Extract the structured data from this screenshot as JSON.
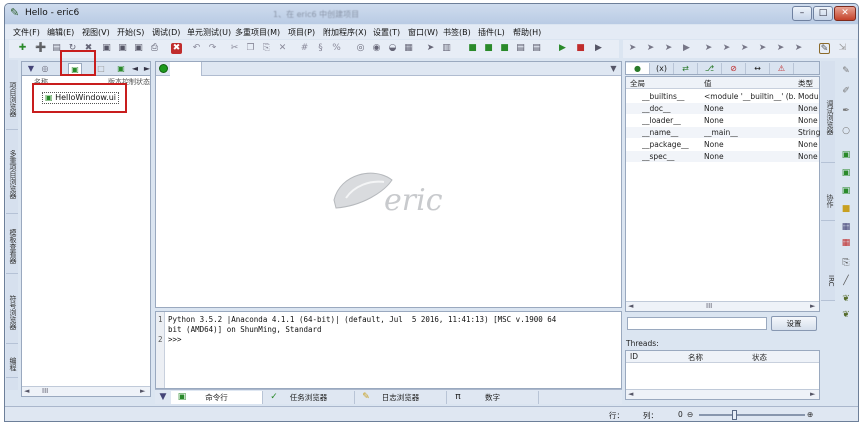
{
  "window": {
    "title": "Hello - eric6",
    "overlay_caption": "1、在 eric6 中创建项目",
    "minimize": "–",
    "maximize": "□",
    "close": "✕"
  },
  "menu": [
    "文件(F)",
    "编辑(E)",
    "视图(V)",
    "开始(S)",
    "调试(D)",
    "单元测试(U)",
    "多重项目(M)",
    "项目(P)",
    "附加程序(X)",
    "设置(T)",
    "窗口(W)",
    "书签(B)",
    "插件(L)",
    "帮助(H)"
  ],
  "left_vertical_tabs": [
    "项目浏览器",
    "多重项目浏览器",
    "模板查看器",
    "符号浏览器",
    "编程"
  ],
  "project_panel": {
    "header_name": "名称",
    "header_vcs": "版本控制状态",
    "tree_item": "HelloWindow.ui"
  },
  "editor": {
    "logo_text": "eric"
  },
  "shell": {
    "line_numbers": [
      "1",
      "",
      "2"
    ],
    "lines": [
      "Python 3.5.2 |Anaconda 4.1.1 (64-bit)| (default, Jul  5 2016, 11:41:13) [MSC v.1900 64",
      "bit (AMD64)] on ShunMing, Standard",
      ">>>"
    ]
  },
  "bottom_tabs": [
    {
      "label": "命令行",
      "icon": "▣"
    },
    {
      "label": "任务浏览器",
      "icon": "✓"
    },
    {
      "label": "日志浏览器",
      "icon": "✎"
    },
    {
      "label": "数字",
      "icon": "π"
    }
  ],
  "debug_tabs": [
    "●",
    "(x)",
    "⇄",
    "⎇",
    "⊘",
    "↔",
    "⚠"
  ],
  "variables": {
    "headers": {
      "name": "全局",
      "value": "值",
      "type": "类型"
    },
    "rows": [
      {
        "name": "__builtins__",
        "value": "<module '__builtin__' (b...",
        "type": "Modu"
      },
      {
        "name": "__doc__",
        "value": "None",
        "type": "None"
      },
      {
        "name": "__loader__",
        "value": "None",
        "type": "None"
      },
      {
        "name": "__name__",
        "value": "__main__",
        "type": "String"
      },
      {
        "name": "__package__",
        "value": "None",
        "type": "None"
      },
      {
        "name": "__spec__",
        "value": "None",
        "type": "None"
      }
    ],
    "filter_button": "设置"
  },
  "threads": {
    "label": "Threads:",
    "headers": {
      "id": "ID",
      "name": "名称",
      "state": "状态"
    }
  },
  "right_vertical_tabs": [
    "调试浏览器",
    "协作",
    "IRC"
  ],
  "status": {
    "line_label": "行：",
    "col_label": "列：",
    "zoom_value": "0",
    "zoom_out": "⊖",
    "zoom_in": "⊕"
  },
  "scroll": {
    "left": "◄",
    "right": "►",
    "grip": "III"
  },
  "colors": {
    "highlight": "#c81d1d",
    "run_green": "#1e9a1e"
  }
}
